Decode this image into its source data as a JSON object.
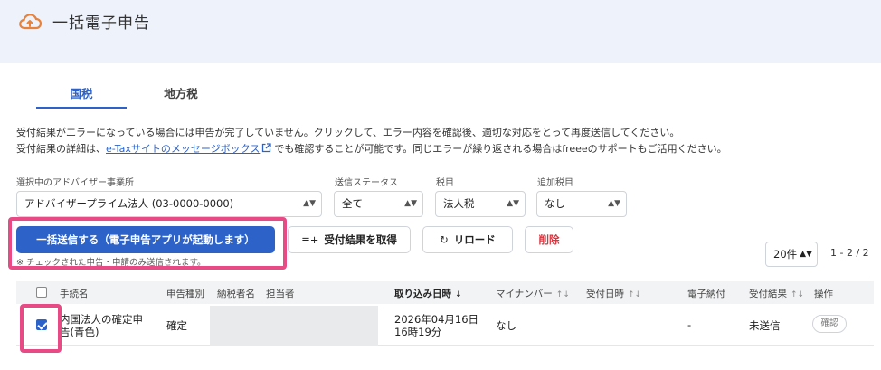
{
  "header": {
    "title": "一括電子申告",
    "icon": "cloud-upload-icon",
    "icon_color": "#e8823a"
  },
  "tabs": [
    {
      "label": "国税",
      "active": true
    },
    {
      "label": "地方税",
      "active": false
    }
  ],
  "notice": {
    "line1": "受付結果がエラーになっている場合には申告が完了していません。クリックして、エラー内容を確認後、適切な対応をとって再度送信してください。",
    "line2_prefix": "受付結果の詳細は、",
    "line2_link": "e-Taxサイトのメッセージボックス",
    "line2_suffix": "でも確認することが可能です。同じエラーが繰り返される場合はfreeeのサポートもご活用ください。"
  },
  "filters": {
    "advisor": {
      "label": "選択中のアドバイザー事業所",
      "value": "アドバイザープライム法人 (03-0000-0000)"
    },
    "status": {
      "label": "送信ステータス",
      "value": "全て"
    },
    "tax_item": {
      "label": "税目",
      "value": "法人税"
    },
    "additional_tax": {
      "label": "追加税目",
      "value": "なし"
    }
  },
  "actions": {
    "bulk_send": "一括送信する（電子申告アプリが起動します）",
    "bulk_send_note": "※ チェックされた申告・申請のみ送信されます。",
    "fetch_results": "受付結果を取得",
    "reload": "リロード",
    "delete": "削除"
  },
  "pagination": {
    "per_page": "20件",
    "range": "1 - 2 / 2"
  },
  "table": {
    "columns": {
      "procedure": "手続名",
      "filing_type": "申告種別",
      "taxpayer": "納税者名",
      "person": "担当者",
      "imported_at": "取り込み日時",
      "my_number": "マイナンバー",
      "received_at": "受付日時",
      "e_payment": "電子納付",
      "result": "受付結果",
      "operation": "操作"
    },
    "rows": [
      {
        "checked": true,
        "procedure_line1": "内国法人の確定申",
        "procedure_line2": "告(青色)",
        "filing_type": "確定",
        "imported_date": "2026年04月16日",
        "imported_time": "16時19分",
        "my_number": "なし",
        "e_payment": "-",
        "result": "未送信",
        "action": "確認"
      }
    ]
  },
  "colors": {
    "accent": "#2d63c8",
    "danger": "#d9353f",
    "highlight": "#e84a86",
    "header_bg": "#eef2fb"
  }
}
